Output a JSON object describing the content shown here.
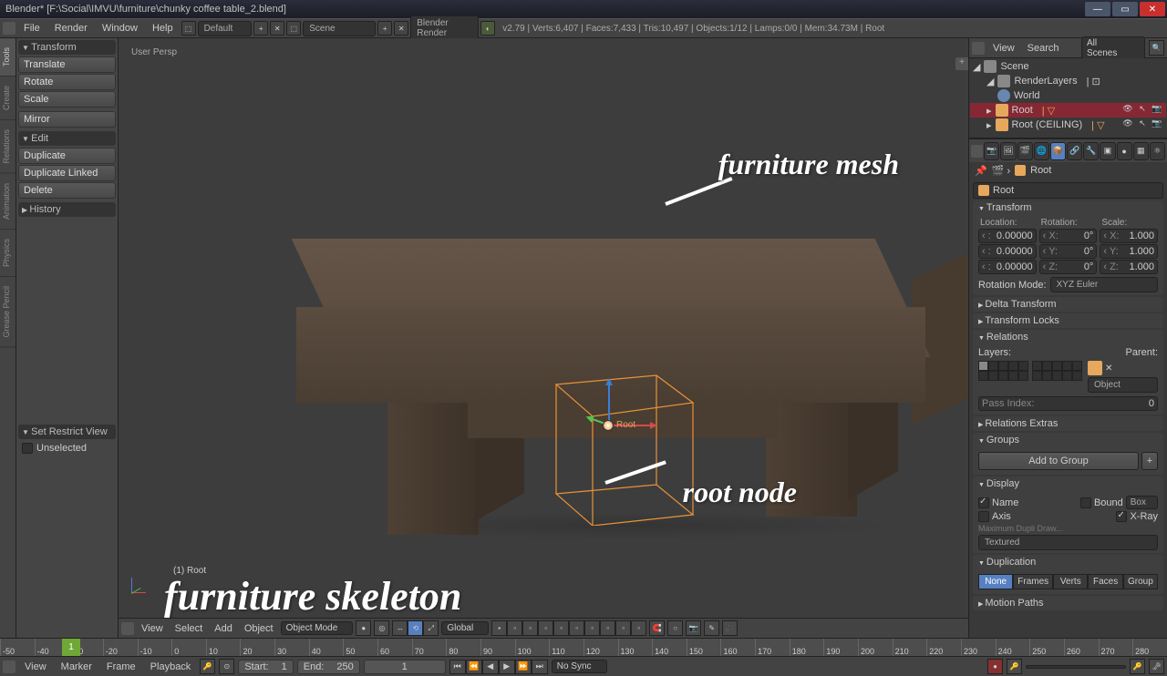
{
  "title": "Blender* [F:\\Social\\IMVU\\furniture\\chunky coffee table_2.blend]",
  "menu": {
    "file": "File",
    "render": "Render",
    "window": "Window",
    "help": "Help",
    "layout": "Default",
    "scene": "Scene",
    "engine": "Blender Render"
  },
  "stats": "v2.79 | Verts:6,407 | Faces:7,433 | Tris:10,497 | Objects:1/12 | Lamps:0/0 | Mem:34.73M | Root",
  "left_tabs": [
    "Tools",
    "Create",
    "Relations",
    "Animation",
    "Physics",
    "Grease Pencil"
  ],
  "tool_panel": {
    "transform": {
      "header": "Transform",
      "translate": "Translate",
      "rotate": "Rotate",
      "scale": "Scale",
      "mirror": "Mirror"
    },
    "edit": {
      "header": "Edit",
      "dup": "Duplicate",
      "duplinked": "Duplicate Linked",
      "del": "Delete"
    },
    "history": "History",
    "set_restrict": "Set Restrict View",
    "unselected": "Unselected"
  },
  "viewport": {
    "label": "User Persp",
    "selection": "(1) Root"
  },
  "view_header": {
    "view": "View",
    "select": "Select",
    "add": "Add",
    "object": "Object",
    "mode": "Object Mode",
    "orient": "Global"
  },
  "annotations": {
    "mesh": "furniture mesh",
    "root": "root node",
    "skeleton": "furniture skeleton"
  },
  "outliner": {
    "view": "View",
    "search": "Search",
    "scenes": "All Scenes",
    "items": {
      "scene": "Scene",
      "render": "RenderLayers",
      "world": "World",
      "root": "Root",
      "ceiling": "Root (CEILING)"
    }
  },
  "props": {
    "object_name": "Root",
    "breadcrumb": "Root",
    "transform_h": "Transform",
    "loc": "Location:",
    "rot": "Rotation:",
    "scl": "Scale:",
    "loc_x": "0.00000",
    "loc_y": "0.00000",
    "loc_z": "0.00000",
    "rot_x": "0°",
    "rot_y": "0°",
    "rot_z": "0°",
    "scl_x": "1.000",
    "scl_y": "1.000",
    "scl_z": "1.000",
    "rot_mode_l": "Rotation Mode:",
    "rot_mode": "XYZ Euler",
    "delta": "Delta Transform",
    "locks": "Transform Locks",
    "relations": "Relations",
    "layers": "Layers:",
    "parent": "Parent:",
    "parent_obj": "Object",
    "pass_l": "Pass Index:",
    "pass_v": "0",
    "rel_extras": "Relations Extras",
    "groups": "Groups",
    "addgroup": "Add to Group",
    "display": "Display",
    "d_name": "Name",
    "d_bound": "Bound",
    "d_box": "Box",
    "d_axis": "Axis",
    "d_xray": "X-Ray",
    "d_maxdupli": "Maximum Dupli Draw...",
    "d_textured": "Textured",
    "duplication": "Duplication",
    "dup_none": "None",
    "dup_frames": "Frames",
    "dup_verts": "Verts",
    "dup_faces": "Faces",
    "dup_group": "Group",
    "motion": "Motion Paths"
  },
  "timeline": {
    "view": "View",
    "marker": "Marker",
    "frame": "Frame",
    "playback": "Playback",
    "start_l": "Start:",
    "start_v": "1",
    "end_l": "End:",
    "end_v": "250",
    "cur": "1",
    "sync": "No Sync",
    "current_frame": "1",
    "ticks": [
      "-50",
      "-40",
      "-30",
      "-20",
      "-10",
      "0",
      "10",
      "20",
      "30",
      "40",
      "50",
      "60",
      "70",
      "80",
      "90",
      "100",
      "110",
      "120",
      "130",
      "140",
      "150",
      "160",
      "170",
      "180",
      "190",
      "200",
      "210",
      "220",
      "230",
      "240",
      "250",
      "260",
      "270",
      "280"
    ]
  }
}
